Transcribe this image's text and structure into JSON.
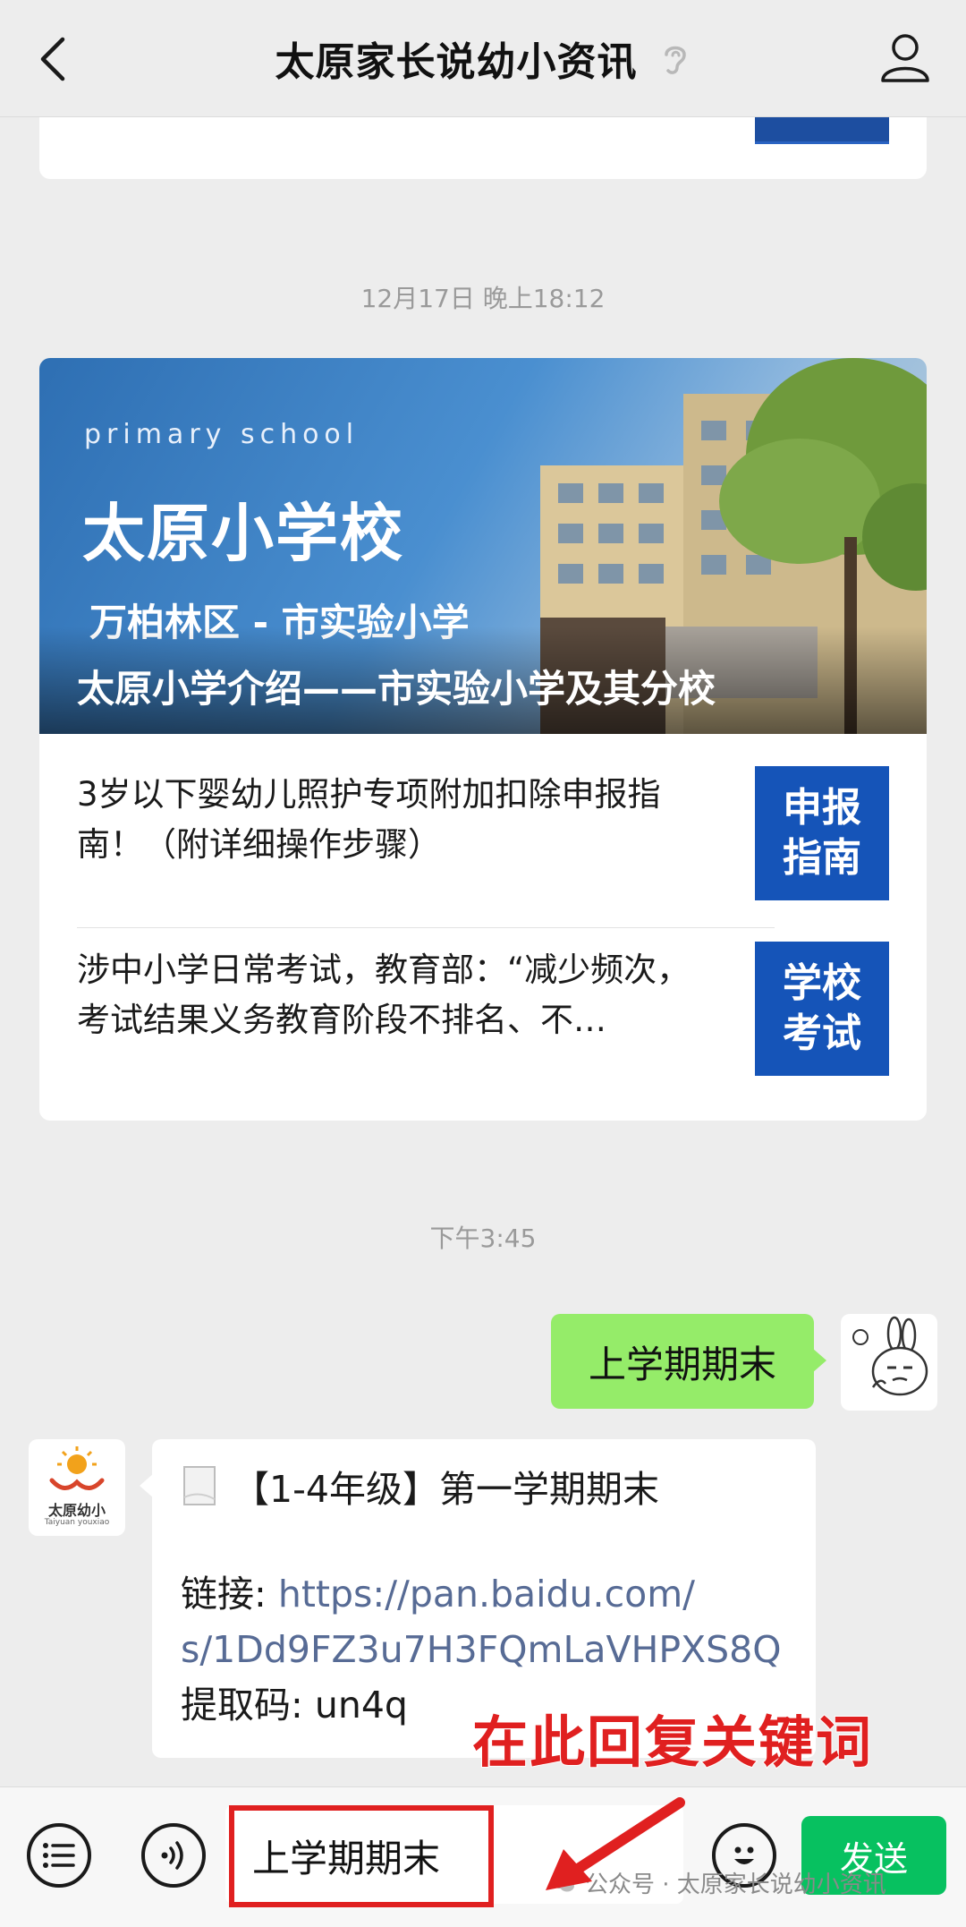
{
  "header": {
    "title": "太原家长说幼小资讯"
  },
  "messages": {
    "time1": "12月17日 晚上18:12",
    "article": {
      "banner_en": "primary school",
      "banner_title": "太原小学校",
      "banner_subtitle": "万柏林区 - 市实验小学",
      "banner_caption": "太原小学介绍——市实验小学及其分校",
      "items": [
        {
          "title_line1": "3岁以下婴幼儿照护专项附加扣除申报指",
          "title_line2": "南！（附详细操作步骤）",
          "thumb_line1": "申报",
          "thumb_line2": "指南"
        },
        {
          "title_line1": "涉中小学日常考试，教育部：“减少频次，",
          "title_line2": "考试结果义务教育阶段不排名、不…",
          "thumb_line1": "学校",
          "thumb_line2": "考试"
        }
      ]
    },
    "time2": "下午3:45",
    "outgoing": "上学期期末",
    "reply": {
      "title": "【1-4年级】第一学期期末",
      "link_label": "链接: ",
      "link_part1": "https://pan.baidu.com/",
      "link_part2": "s/1Dd9FZ3u7H3FQmLaVHPXS8Q",
      "code": "提取码: un4q"
    },
    "bot_avatar_text": "太原幼小",
    "bot_avatar_subtext": "Taiyuan youxiao"
  },
  "annotation": "在此回复关键词",
  "bottom": {
    "input_value": "上学期期末",
    "send_label": "发送",
    "watermark": "公众号 · 太原家长说幼小资讯"
  },
  "colors": {
    "accent_green": "#07c160",
    "bubble_green": "#95ec69",
    "annotation_red": "#e02020",
    "link_blue": "#576b95"
  }
}
